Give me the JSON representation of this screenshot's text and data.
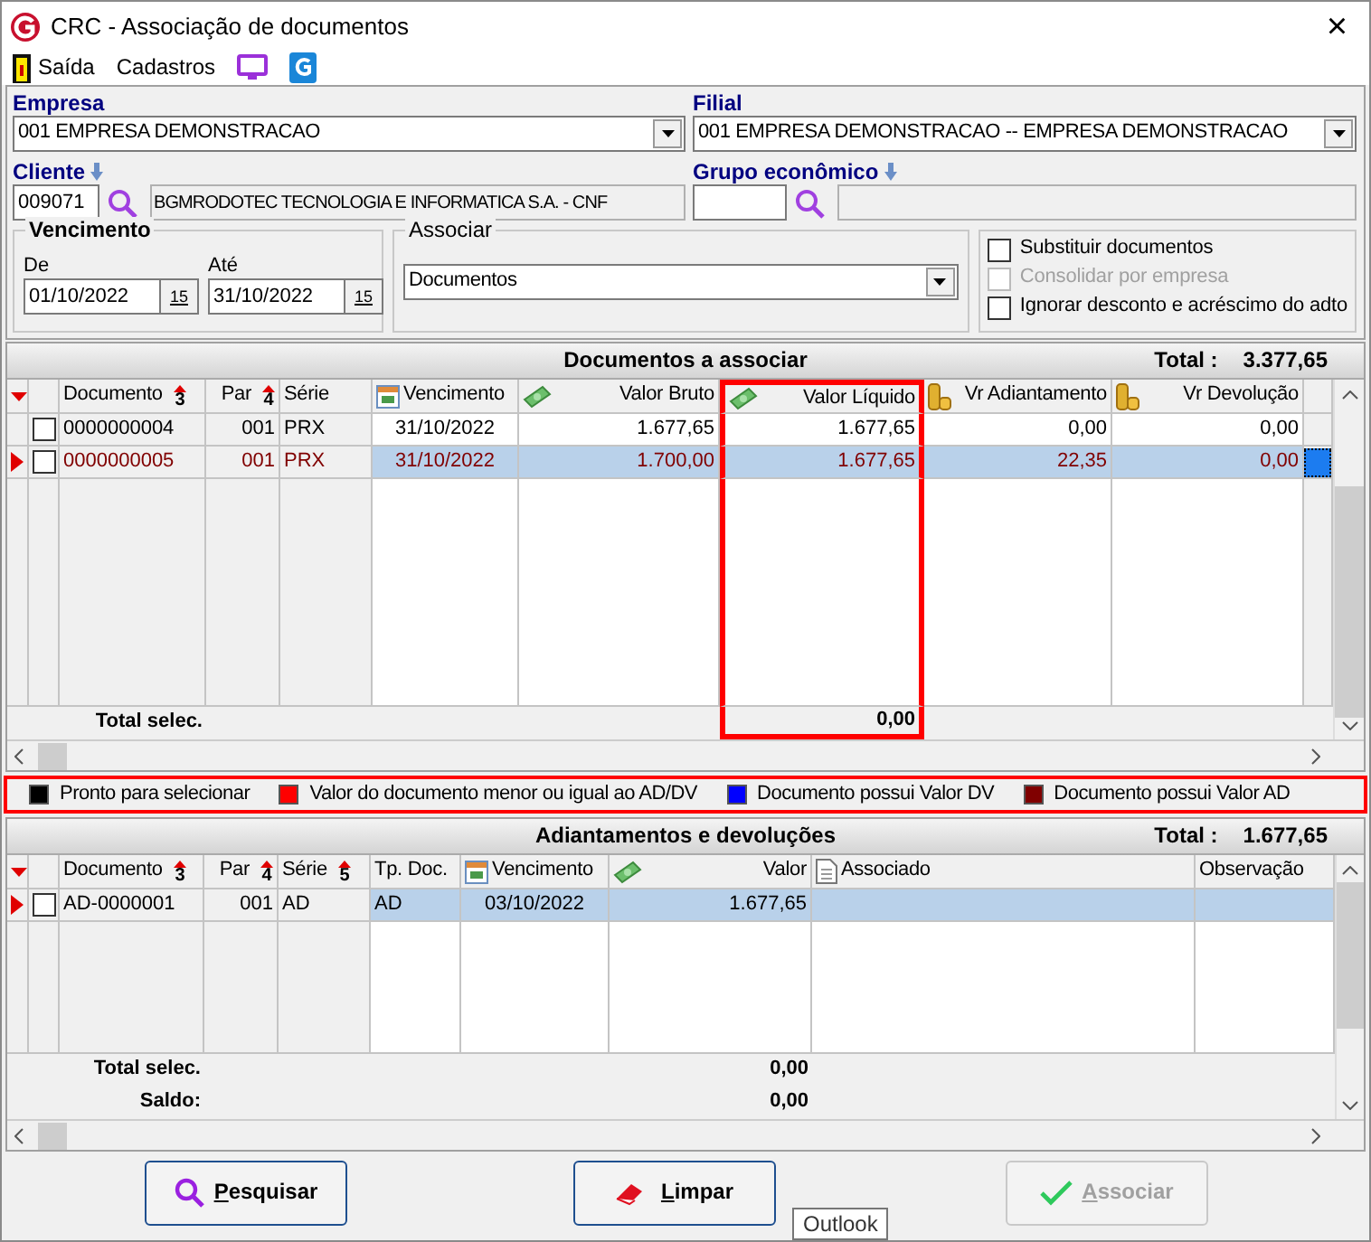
{
  "window": {
    "title": "CRC - Associação de documentos",
    "close": "×"
  },
  "menu": [
    {
      "kind": "exit",
      "label": "Saída"
    },
    {
      "kind": "text",
      "label": "Cadastros"
    },
    {
      "kind": "monitor"
    },
    {
      "kind": "app"
    }
  ],
  "empresa": {
    "label": "Empresa",
    "value": "001 EMPRESA DEMONSTRACAO"
  },
  "filial": {
    "label": "Filial",
    "value": "001 EMPRESA DEMONSTRACAO -- EMPRESA DEMONSTRACAO"
  },
  "cliente": {
    "label": "Cliente",
    "code": "009071",
    "name": "BGMRODOTEC TECNOLOGIA E INFORMATICA S.A. - CNF"
  },
  "grupo": {
    "label": "Grupo econômico"
  },
  "vencimento": {
    "title": "Vencimento",
    "from_label": "De",
    "from": "01/10/2022",
    "from_button": "15",
    "to_label": "Até",
    "to": "31/10/2022",
    "to_button": "15"
  },
  "associar": {
    "title": "Associar",
    "value": "Documentos"
  },
  "options": [
    {
      "label": "Substituir documentos",
      "checked": false,
      "disabled": false
    },
    {
      "label": "Consolidar por empresa",
      "checked": false,
      "disabled": true
    },
    {
      "label": "Ignorar desconto e acréscimo do adto",
      "checked": false,
      "disabled": false
    }
  ],
  "documents": {
    "title": "Documentos a associar",
    "total_label": "Total :",
    "total": "3.377,65",
    "columns": [
      {
        "label": "Documento",
        "kind": "text",
        "sort": "3",
        "fixed": true,
        "highlighted": false
      },
      {
        "label": "Par",
        "kind": "number",
        "sort": "4",
        "fixed": true,
        "highlighted": false
      },
      {
        "label": "Série",
        "kind": "text",
        "fixed": true,
        "highlighted": false
      },
      {
        "label": "Vencimento",
        "kind": "date",
        "fixed": false,
        "highlighted": false
      },
      {
        "label": "Valor Bruto",
        "kind": "amount",
        "fixed": false,
        "highlighted": false
      },
      {
        "label": "Valor Líquido",
        "kind": "amount",
        "fixed": false,
        "highlighted": true
      },
      {
        "label": "Vr Adiantamento",
        "kind": "advance",
        "fixed": false,
        "highlighted": false
      },
      {
        "label": "Vr Devolução",
        "kind": "advance",
        "fixed": false,
        "highlighted": false
      }
    ],
    "rows": [
      {
        "selected": false,
        "checked": false,
        "color": "#000000",
        "cells": [
          "0000000004",
          "001",
          "PRX",
          "31/10/2022",
          "1.677,65",
          "1.677,65",
          "0,00",
          "0,00"
        ]
      },
      {
        "selected": true,
        "checked": false,
        "color": "#800000",
        "cells": [
          "0000000005",
          "001",
          "PRX",
          "31/10/2022",
          "1.700,00",
          "1.677,65",
          "22,35",
          "0,00"
        ]
      }
    ],
    "totals": [
      {
        "cells": [
          "Total selec.",
          null,
          null,
          null,
          null,
          "0,00",
          null,
          null
        ]
      }
    ]
  },
  "legend": {
    "highlighted": true,
    "items": [
      {
        "label": "Pronto para selecionar",
        "color": "#000000"
      },
      {
        "label": "Valor do documento menor ou igual ao AD/DV",
        "color": "#ff0000"
      },
      {
        "label": "Documento possui Valor DV",
        "color": "#0000ff"
      },
      {
        "label": "Documento possui Valor AD",
        "color": "#800000"
      }
    ]
  },
  "advances": {
    "title": "Adiantamentos e devoluções",
    "total_label": "Total :",
    "total": "1.677,65",
    "columns": [
      {
        "label": "Documento",
        "kind": "text",
        "sort": "3",
        "fixed": true,
        "highlighted": false
      },
      {
        "label": "Par",
        "kind": "number",
        "sort": "4",
        "fixed": true,
        "highlighted": false
      },
      {
        "label": "Série",
        "kind": "text",
        "sort": "5",
        "fixed": true,
        "highlighted": false
      },
      {
        "label": "Tp. Doc.",
        "kind": "text",
        "fixed": false,
        "highlighted": false
      },
      {
        "label": "Vencimento",
        "kind": "date",
        "fixed": false,
        "highlighted": false
      },
      {
        "label": "Valor",
        "kind": "amount",
        "fixed": false,
        "highlighted": false
      },
      {
        "label": "Associado",
        "kind": "note",
        "fixed": false,
        "highlighted": false
      },
      {
        "label": "Observação",
        "kind": "text",
        "fixed": false,
        "highlighted": false
      }
    ],
    "rows": [
      {
        "selected": true,
        "checked": false,
        "color": "#000000",
        "cells": [
          "AD-0000001",
          "001",
          "AD",
          "AD",
          "03/10/2022",
          "1.677,65"
        ]
      }
    ],
    "totals": [
      {
        "cells": [
          "Total selec.",
          null,
          null,
          null,
          null,
          "0,00",
          null,
          null
        ]
      },
      {
        "cells": [
          "Saldo:",
          null,
          null,
          null,
          null,
          "0,00",
          null,
          null
        ]
      }
    ]
  },
  "buttons": [
    {
      "kind": "search",
      "label": "Pesquisar",
      "disabled": false,
      "mnemonic": true
    },
    {
      "kind": "clear",
      "label": "Limpar",
      "disabled": false,
      "mnemonic": true
    },
    {
      "kind": "confirm",
      "label": "Associar",
      "disabled": true,
      "mnemonic": true
    }
  ],
  "tooltip": "Outlook"
}
